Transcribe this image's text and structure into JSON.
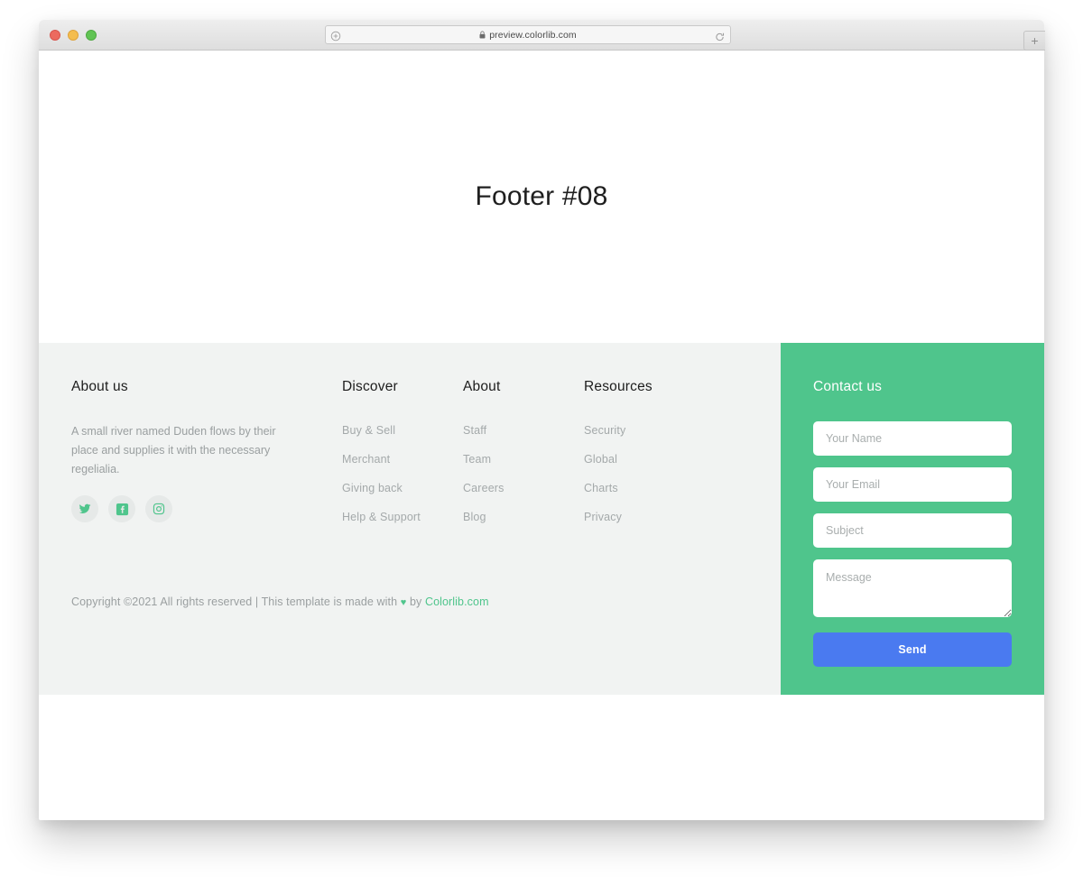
{
  "browser": {
    "url": "preview.colorlib.com",
    "lock_icon": "lock-icon",
    "reload_icon": "reload-icon",
    "newtab_label": "+",
    "traffic_lights": [
      "close",
      "minimize",
      "maximize"
    ]
  },
  "hero": {
    "title": "Footer #08"
  },
  "footer": {
    "about": {
      "title": "About us",
      "text": "A small river named Duden flows by their place and supplies it with the necessary regelialia.",
      "social": [
        {
          "name": "twitter-icon",
          "label": "Twitter"
        },
        {
          "name": "facebook-icon",
          "label": "Facebook"
        },
        {
          "name": "instagram-icon",
          "label": "Instagram"
        }
      ]
    },
    "columns": [
      {
        "title": "Discover",
        "links": [
          "Buy & Sell",
          "Merchant",
          "Giving back",
          "Help & Support"
        ]
      },
      {
        "title": "About",
        "links": [
          "Staff",
          "Team",
          "Careers",
          "Blog"
        ]
      },
      {
        "title": "Resources",
        "links": [
          "Security",
          "Global",
          "Charts",
          "Privacy"
        ]
      }
    ],
    "copyright": {
      "prefix": "Copyright ©2021 All rights reserved | This template is made with ",
      "heart": "♥",
      "middle": " by ",
      "link": "Colorlib.com"
    },
    "contact": {
      "title": "Contact us",
      "fields": [
        {
          "name": "name-field",
          "placeholder": "Your Name",
          "value": ""
        },
        {
          "name": "email-field",
          "placeholder": "Your Email",
          "value": ""
        },
        {
          "name": "subject-field",
          "placeholder": "Subject",
          "value": ""
        }
      ],
      "message": {
        "placeholder": "Message",
        "value": ""
      },
      "send_label": "Send"
    }
  },
  "colors": {
    "accent_green": "#4fc58c",
    "button_blue": "#4a7af0",
    "footer_bg": "#f1f3f2",
    "muted_text": "#9a9fa0"
  }
}
